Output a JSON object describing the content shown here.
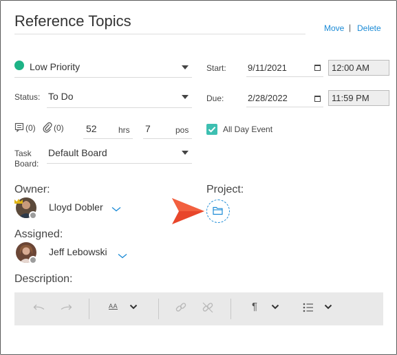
{
  "header": {
    "title": "Reference Topics",
    "move_label": "Move",
    "separator": "|",
    "delete_label": "Delete"
  },
  "priority": {
    "value": "Low Priority",
    "color": "#1db386"
  },
  "status": {
    "label": "Status:",
    "value": "To Do"
  },
  "counts": {
    "comments": "(0)",
    "attachments": "(0)"
  },
  "estimate": {
    "hours": "52",
    "hours_unit": "hrs",
    "points": "7",
    "points_unit": "pos"
  },
  "task_board": {
    "label": "Task Board:",
    "value": "Default Board"
  },
  "start": {
    "label": "Start:",
    "date": "9/11/2021",
    "time": "12:00 AM"
  },
  "due": {
    "label": "Due:",
    "date": "2/28/2022",
    "time": "11:59 PM"
  },
  "all_day": {
    "label": "All Day Event",
    "checked": true
  },
  "owner": {
    "label": "Owner:",
    "name": "Lloyd Dobler"
  },
  "project": {
    "label": "Project:"
  },
  "assigned": {
    "label": "Assigned:",
    "name": "Jeff Lebowski"
  },
  "description": {
    "label": "Description:"
  },
  "toolbar": {
    "icons": [
      "undo-icon",
      "redo-icon",
      "font-size-icon",
      "chevron-down-icon",
      "link-icon",
      "unlink-icon",
      "paragraph-icon",
      "chevron-down-icon",
      "list-icon",
      "chevron-down-icon"
    ],
    "font_size_glyph": "AA",
    "paragraph_glyph": "¶"
  },
  "colors": {
    "accent": "#1a8ad6",
    "check": "#3dbfb1",
    "pointer": "#e8462b"
  }
}
